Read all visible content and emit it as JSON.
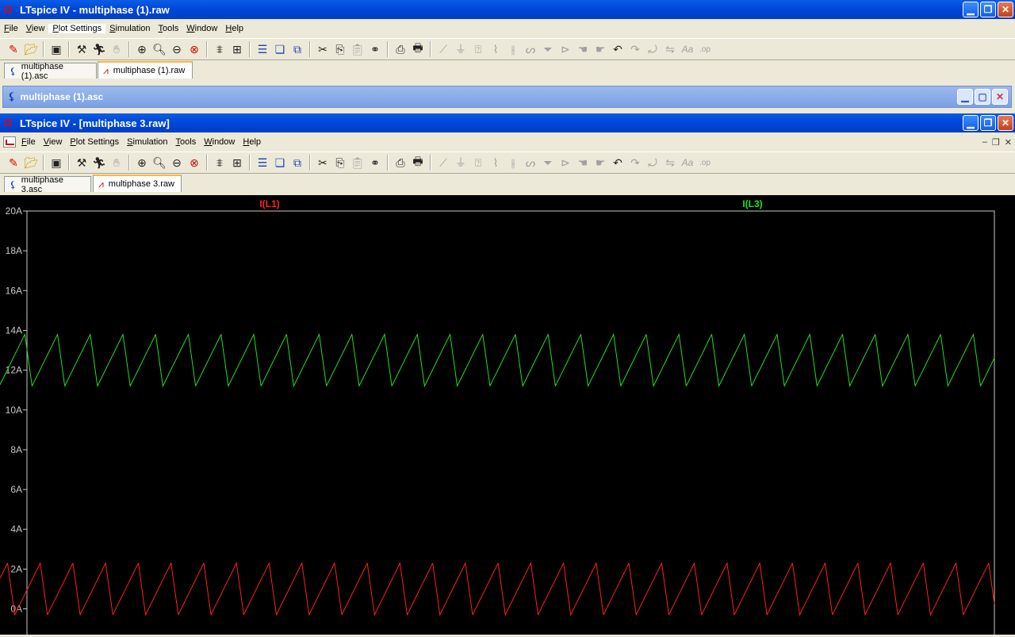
{
  "outer_window": {
    "title": "LTspice IV - multiphase (1).raw",
    "menu": [
      "File",
      "View",
      "Plot Settings",
      "Simulation",
      "Tools",
      "Window",
      "Help"
    ],
    "tabs": [
      "multiphase (1).asc",
      "multiphase (1).raw"
    ]
  },
  "inner_schematic_window": {
    "title": "multiphase (1).asc"
  },
  "main_window": {
    "title": "LTspice IV - [multiphase 3.raw]",
    "menu": [
      "File",
      "View",
      "Plot Settings",
      "Simulation",
      "Tools",
      "Window",
      "Help"
    ],
    "tabs": [
      "multiphase 3.asc",
      "multiphase 3.raw"
    ]
  },
  "toolbar_icons": [
    "new-schematic",
    "open",
    "save",
    "control-panel",
    "run",
    "halt",
    "zoom-in",
    "zoom-pan",
    "zoom-out",
    "zoom-fit",
    "autorange",
    "mark-unref",
    "tile-horizontal",
    "cascade",
    "tile-vertical",
    "cut",
    "copy",
    "paste",
    "find",
    "print-setup",
    "print",
    "wire",
    "ground",
    "label",
    "resistor",
    "capacitor",
    "inductor",
    "diode",
    "component",
    "move",
    "drag",
    "undo",
    "redo",
    "rotate",
    "mirror",
    "text",
    "spice-directive"
  ],
  "chart_data": {
    "type": "line",
    "yunit": "A",
    "ylim": [
      0,
      20
    ],
    "yticks": [
      "20A",
      "18A",
      "16A",
      "14A",
      "12A",
      "10A",
      "8A",
      "6A",
      "4A",
      "2A",
      "0A"
    ],
    "grid": false,
    "cycles": 29.7,
    "series": [
      {
        "name": "I(L1)",
        "color": "#ff2020",
        "min": -0.3,
        "max": 2.3,
        "start_phase": 0.55
      },
      {
        "name": "I(L3)",
        "color": "#20e020",
        "min": 11.2,
        "max": 13.8,
        "start_phase": 0.02
      }
    ],
    "colors": {
      "background": "#000000",
      "axis": "#c8c8c8"
    }
  }
}
